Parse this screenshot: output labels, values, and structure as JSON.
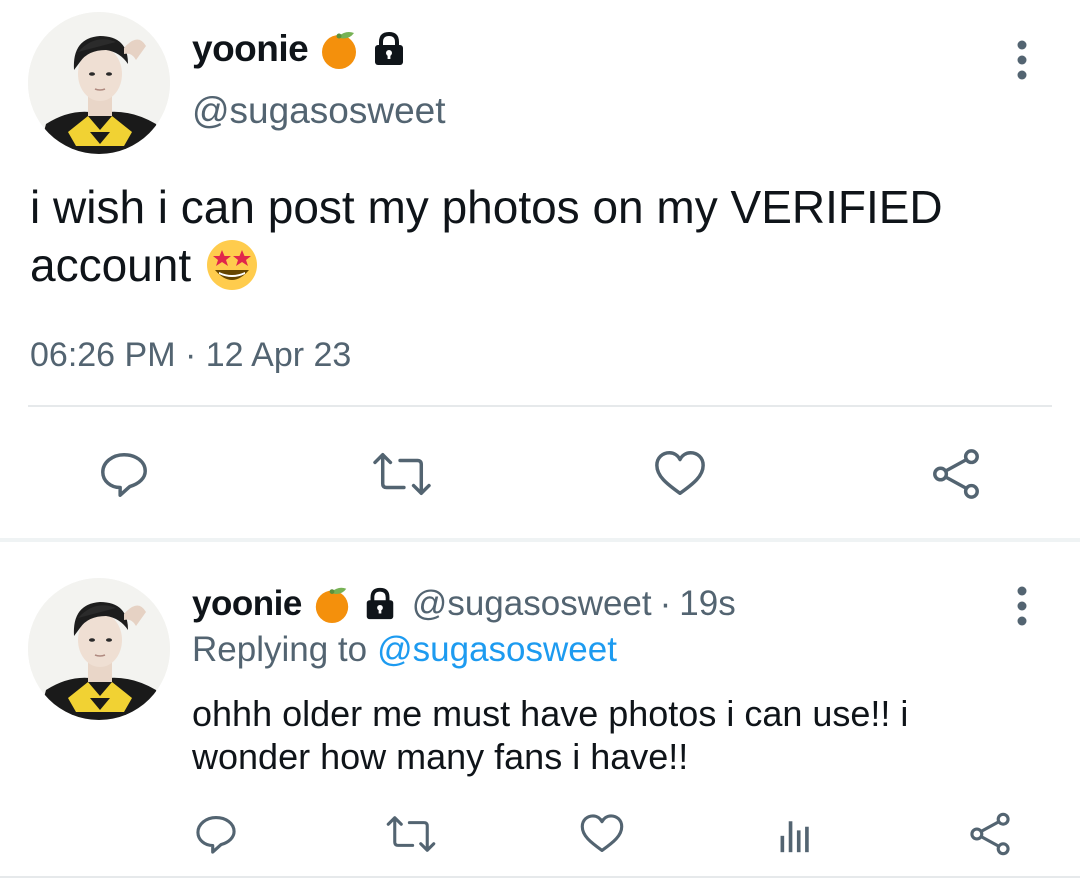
{
  "main_tweet": {
    "author": {
      "display_name": "yoonie",
      "handle": "@sugasosweet",
      "badges": [
        "tangerine-emoji",
        "locked-icon"
      ]
    },
    "text_line1": "i wish i can post my photos on my VERIFIED",
    "text_line2": "account",
    "text_emoji": "star-struck-emoji",
    "time": "06:26 PM",
    "separator": "·",
    "date": "12 Apr 23",
    "actions": [
      "reply-icon",
      "retweet-icon",
      "like-icon",
      "share-icon"
    ]
  },
  "reply_tweet": {
    "author": {
      "display_name": "yoonie",
      "handle": "@sugasosweet",
      "separator": "·",
      "age": "19s"
    },
    "replying_prefix": "Replying to",
    "replying_to": "@sugasosweet",
    "text_line1": "ohhh older me must have photos i can use!! i",
    "text_line2": "wonder how many fans i have!!",
    "actions": [
      "reply-icon",
      "retweet-icon",
      "like-icon",
      "views-icon",
      "share-icon"
    ]
  },
  "colors": {
    "text": "#0f1419",
    "muted": "#536471",
    "link": "#1d9bf0",
    "icon": "#536471",
    "divider": "#e6e9eb"
  }
}
